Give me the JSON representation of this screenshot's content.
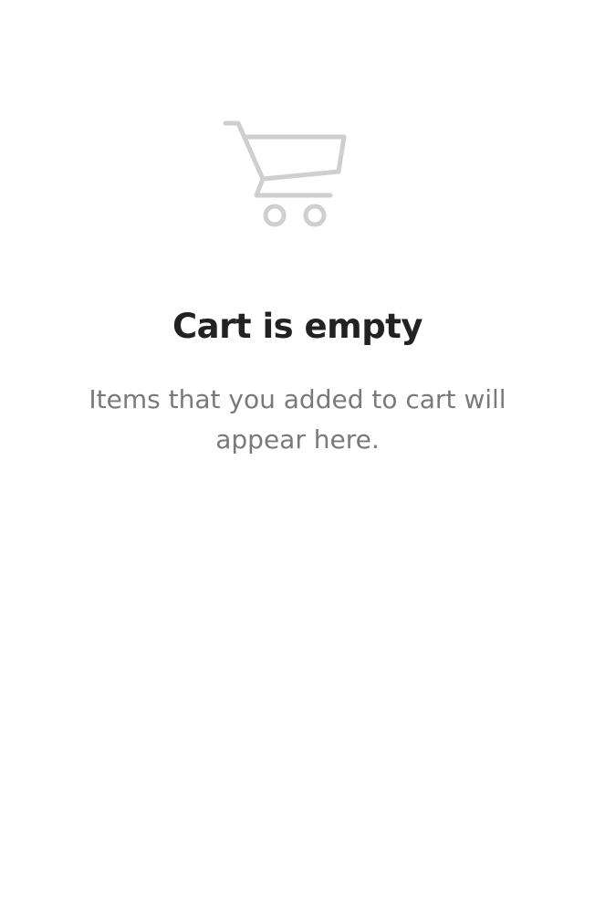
{
  "empty_cart": {
    "icon": "shopping-cart-icon",
    "icon_color": "#cfcfcf",
    "title": "Cart is empty",
    "message": "Items that you added to cart will appear here."
  },
  "colors": {
    "background": "#ffffff",
    "title": "#222222",
    "message": "#7a7a7a"
  }
}
